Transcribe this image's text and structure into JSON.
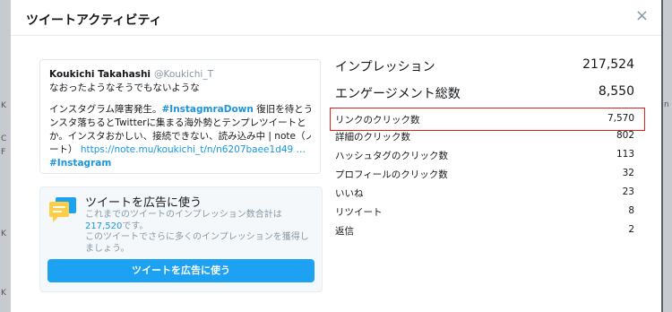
{
  "backdrop": {
    "left_fragments": [
      "K",
      "C",
      "F",
      "K",
      "K"
    ],
    "right_fragments": [
      "n"
    ]
  },
  "modal": {
    "title": "ツイートアクティビティ",
    "close_glyph": "×"
  },
  "tweet": {
    "author_name": "Koukichi Takahashi",
    "handle": "@Koukichi_T",
    "line1": "なおったようなそうでもないような",
    "line2_prefix": "インスタグラム障害発生。",
    "line2_hashtag": "#InstagmraDown",
    "line2_suffix": " 復旧を待とう。イ",
    "line3": "ンスタ落ちるとTwitterに集まる海外勢とテンプレツイートと",
    "line4": "か。インスタおかしい、接続できない、読み込み中 | note（ノ",
    "line5_prefix": "ート）",
    "line5_link": "https://note.mu/koukichi_t/n/n6207baee1d49 …",
    "line6_hashtag": "#Instagram"
  },
  "promo": {
    "title": "ツイートを広告に使う",
    "desc_prefix": "これまでのツイートのインプレッション数合計は",
    "impressions_total": "217,520",
    "desc_mid": "です。",
    "desc_suffix": "このツイートでさらに多くのインプレッションを獲得しましょう。",
    "button_label": "ツイートを広告に使う"
  },
  "metrics": {
    "impressions": {
      "label": "インプレッション",
      "value": "217,524"
    },
    "engagements": {
      "label": "エンゲージメント総数",
      "value": "8,550"
    },
    "rows": [
      {
        "label": "リンクのクリック数",
        "value": "7,570",
        "highlighted": true
      },
      {
        "label": "詳細のクリック数",
        "value": "802"
      },
      {
        "label": "ハッシュタグのクリック数",
        "value": "113"
      },
      {
        "label": "プロフィールのクリック数",
        "value": "32"
      },
      {
        "label": "いいね",
        "value": "23"
      },
      {
        "label": "リツイート",
        "value": "8"
      },
      {
        "label": "返信",
        "value": "2"
      }
    ],
    "highlight_color": "#e0201d"
  },
  "colors": {
    "accent": "#1da1f2",
    "link": "#1b95e0",
    "muted": "#8899a6"
  }
}
